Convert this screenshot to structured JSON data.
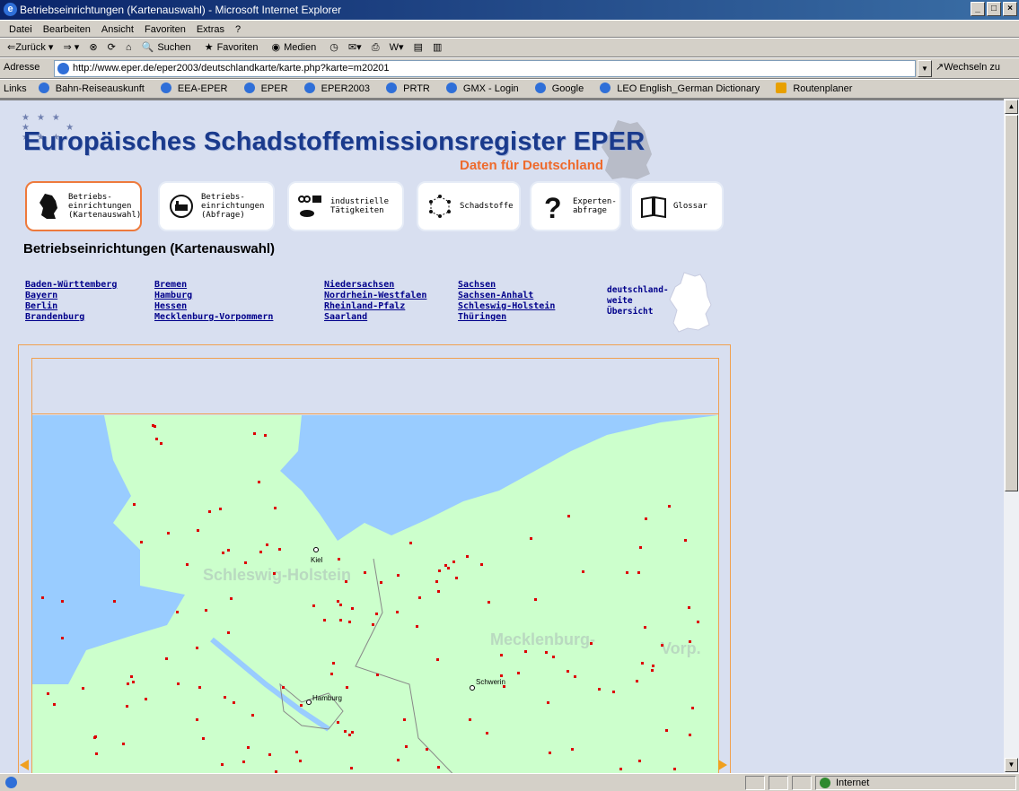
{
  "window": {
    "title": "Betriebseinrichtungen (Kartenauswahl) - Microsoft Internet Explorer"
  },
  "menu": [
    "Datei",
    "Bearbeiten",
    "Ansicht",
    "Favoriten",
    "Extras",
    "?"
  ],
  "toolbar": {
    "back": "⇐Zurück ▾",
    "forward": "⇒ ▾",
    "search": "Suchen",
    "favorites": "Favoriten",
    "media": "Medien"
  },
  "address": {
    "label": "Adresse",
    "url": "http://www.eper.de/eper2003/deutschlandkarte/karte.php?karte=m20201",
    "go": "Wechseln zu"
  },
  "links": {
    "label": "Links",
    "items": [
      "Bahn-Reiseauskunft",
      "EEA-EPER",
      "EPER",
      "EPER2003",
      "PRTR",
      "GMX - Login",
      "Google",
      "LEO English_German Dictionary",
      "Routenplaner"
    ]
  },
  "header": {
    "title": "Europäisches Schadstoffemissionsregister EPER",
    "subtitle": "Daten für Deutschland"
  },
  "nav": [
    {
      "label": "Betriebs-\neinrichtungen\n(Kartenauswahl)",
      "icon": "germany-map-icon"
    },
    {
      "label": "Betriebs-\neinrichtungen\n(Abfrage)",
      "icon": "factory-magnifier-icon"
    },
    {
      "label": "industrielle\nTätigkeiten",
      "icon": "industry-icon"
    },
    {
      "label": "Schadstoffe",
      "icon": "molecule-icon"
    },
    {
      "label": "Experten-\nabfrage",
      "icon": "question-icon"
    },
    {
      "label": "Glossar",
      "icon": "book-icon"
    }
  ],
  "page_title": "Betriebseinrichtungen (Kartenauswahl)",
  "states": [
    [
      "Baden-Württemberg",
      "Bayern",
      "Berlin",
      "Brandenburg"
    ],
    [
      "Bremen",
      "Hamburg",
      "Hessen",
      "Mecklenburg-Vorpommern"
    ],
    [
      "Niedersachsen",
      "Nordrhein-Westfalen",
      "Rheinland-Pfalz",
      "Saarland"
    ],
    [
      "Sachsen",
      "Sachsen-Anhalt",
      "Schleswig-Holstein",
      "Thüringen"
    ]
  ],
  "germany_link": "deutschland-\nweite\nÜbersicht",
  "map": {
    "regions": [
      "Schleswig-Holstein",
      "Mecklenburg-",
      "Vorp."
    ],
    "cities": [
      "Kiel",
      "Schwerin",
      "Hamburg"
    ],
    "colors": {
      "water": "#99ccff",
      "land": "#ccffcc",
      "facility": "#dd0000",
      "region_label": "#b9d9c0"
    }
  },
  "status": {
    "zone": "Internet"
  }
}
